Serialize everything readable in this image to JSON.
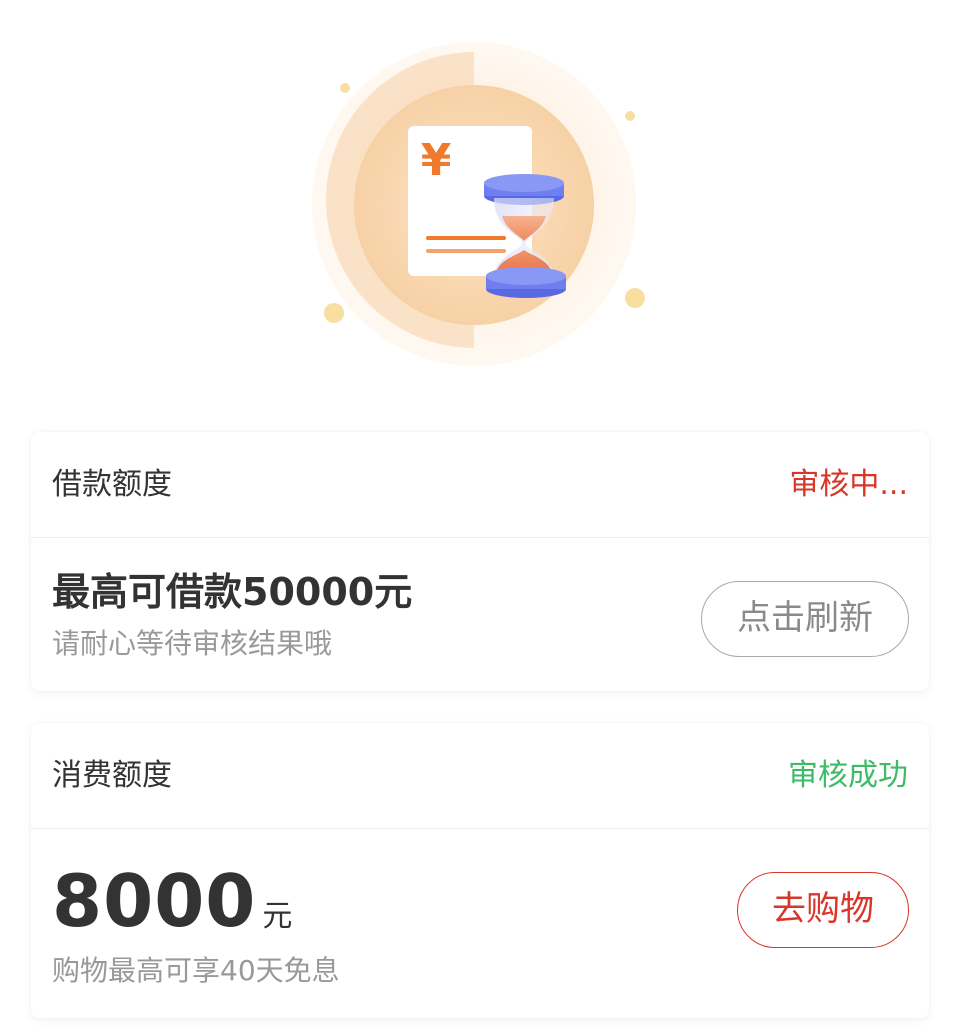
{
  "hero": {
    "currency_symbol": "¥",
    "illustration_icon": "hourglass-document-icon"
  },
  "loan_card": {
    "title": "借款额度",
    "status": "审核中...",
    "main_text": "最高可借款50000元",
    "sub_text": "请耐心等待审核结果哦",
    "button_label": "点击刷新"
  },
  "consume_card": {
    "title": "消费额度",
    "status": "审核成功",
    "amount": "8000",
    "unit": "元",
    "sub_text": "购物最高可享40天免息",
    "button_label": "去购物"
  },
  "colors": {
    "pending": "#d9362a",
    "success": "#3dbb66",
    "accent_red": "#d9362a",
    "hourglass_blue": "#6f7ff0",
    "orange": "#f08a4b"
  }
}
